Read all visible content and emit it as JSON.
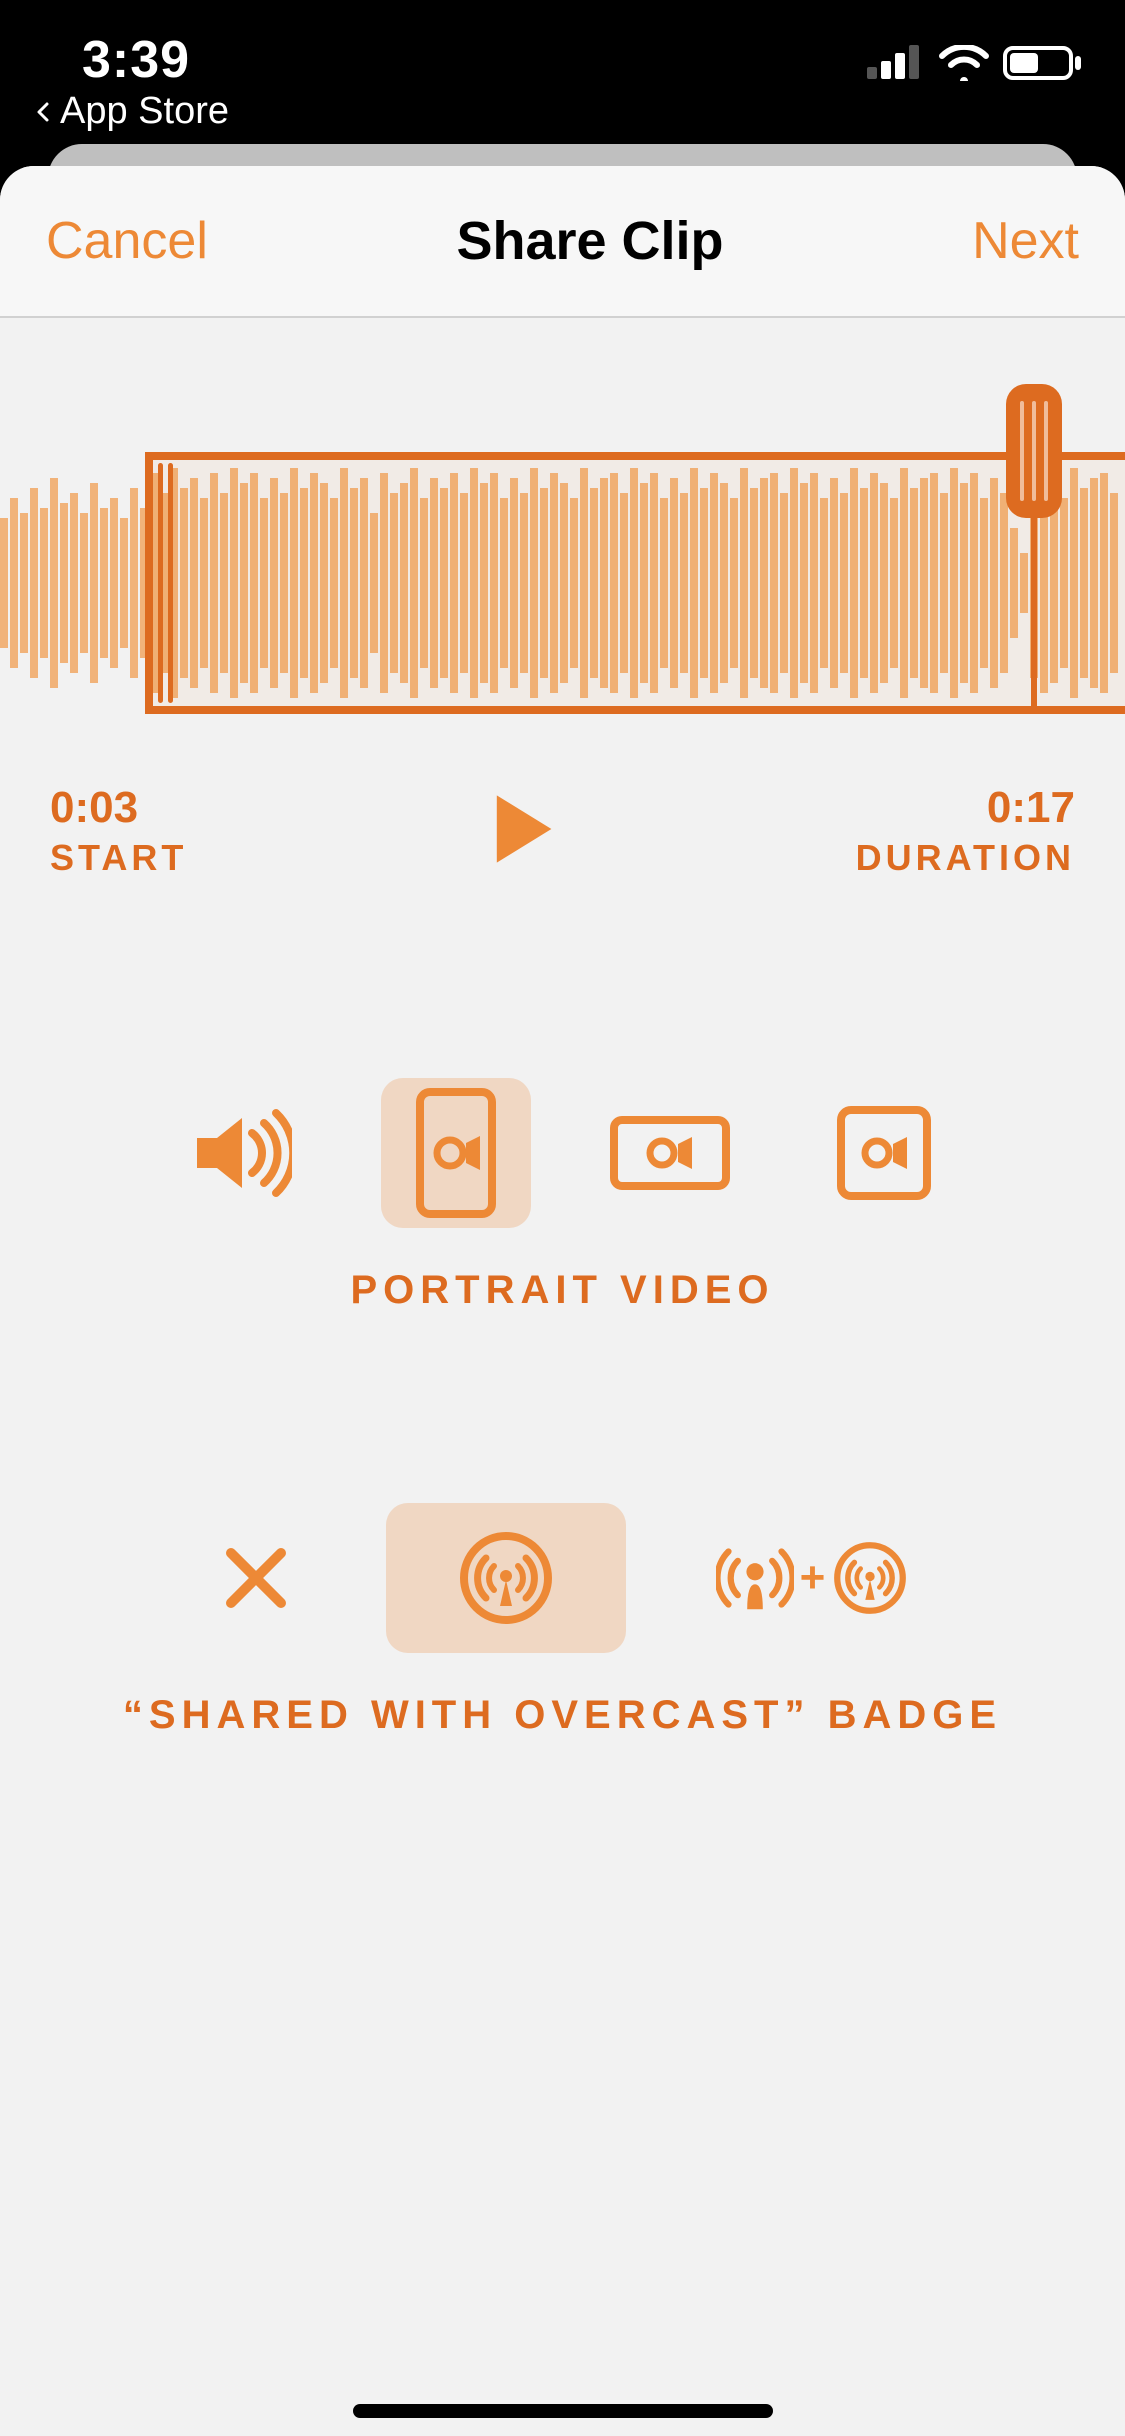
{
  "status_bar": {
    "time": "3:39",
    "back_app": "App Store"
  },
  "navbar": {
    "cancel": "Cancel",
    "title": "Share Clip",
    "next": "Next"
  },
  "clip": {
    "start_time": "0:03",
    "start_label": "START",
    "duration_time": "0:17",
    "duration_label": "DURATION"
  },
  "format": {
    "options": [
      "audio",
      "portrait-video",
      "landscape-video",
      "square-video"
    ],
    "selected": "portrait-video",
    "label": "PORTRAIT VIDEO"
  },
  "badge": {
    "options": [
      "none",
      "overcast",
      "podcast-and-overcast"
    ],
    "selected": "overcast",
    "label": "“SHARED WITH OVERCAST” BADGE"
  },
  "colors": {
    "accent": "#ED8936"
  }
}
